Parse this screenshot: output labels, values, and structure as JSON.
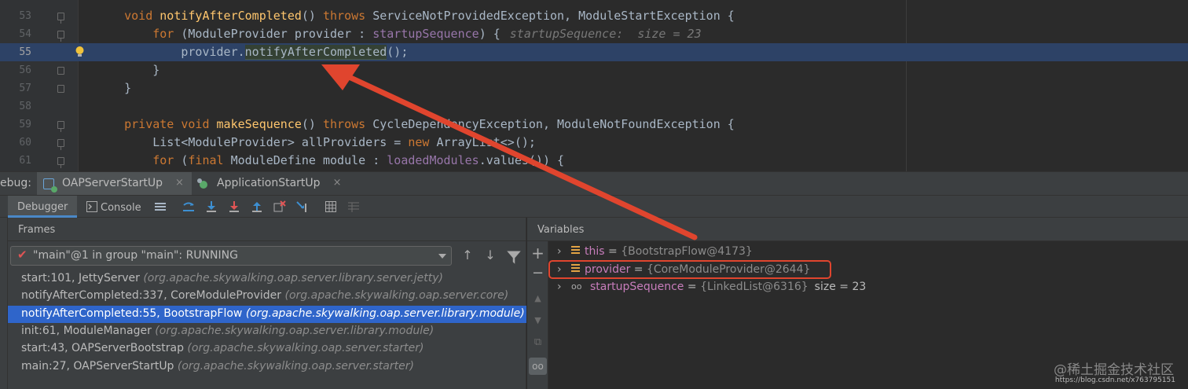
{
  "editor": {
    "lines": [
      {
        "num": "53",
        "parts": [
          [
            "    ",
            ""
          ],
          [
            "void ",
            "kw"
          ],
          [
            "notifyAfterCompleted",
            "fn"
          ],
          [
            "() ",
            ""
          ],
          [
            "throws ",
            "kw"
          ],
          [
            "ServiceNotProvidedException, ModuleStartException {",
            ""
          ]
        ]
      },
      {
        "num": "54",
        "parts": [
          [
            "        ",
            ""
          ],
          [
            "for ",
            "kw"
          ],
          [
            "(ModuleProvider provider : ",
            ""
          ],
          [
            "startupSequence",
            "fld"
          ],
          [
            ") {",
            ""
          ]
        ],
        "hint": "startupSequence:  size = 23"
      },
      {
        "num": "55",
        "parts": [
          [
            "            provider.",
            ""
          ],
          [
            "notifyAfterCompleted",
            "mcall"
          ],
          [
            "();",
            ""
          ]
        ]
      },
      {
        "num": "56",
        "parts": [
          [
            "        }",
            ""
          ]
        ]
      },
      {
        "num": "57",
        "parts": [
          [
            "    }",
            ""
          ]
        ]
      },
      {
        "num": "58",
        "parts": [
          [
            "",
            ""
          ]
        ]
      },
      {
        "num": "59",
        "parts": [
          [
            "    ",
            ""
          ],
          [
            "private void ",
            "kw"
          ],
          [
            "makeSequence",
            "fn"
          ],
          [
            "() ",
            ""
          ],
          [
            "throws ",
            "kw"
          ],
          [
            "CycleDependencyException, ModuleNotFoundException {",
            ""
          ]
        ]
      },
      {
        "num": "60",
        "parts": [
          [
            "        List<ModuleProvider> allProviders = ",
            ""
          ],
          [
            "new ",
            "kw"
          ],
          [
            "ArrayList<>();",
            ""
          ]
        ]
      },
      {
        "num": "61",
        "parts": [
          [
            "        ",
            ""
          ],
          [
            "for ",
            "kw"
          ],
          [
            "(",
            ""
          ],
          [
            "final ",
            "kw"
          ],
          [
            "ModuleDefine module : ",
            ""
          ],
          [
            "loadedModules",
            "fld"
          ],
          [
            ".values()) {",
            ""
          ]
        ]
      }
    ]
  },
  "debug": {
    "label": "ebug:",
    "tabs": [
      {
        "label": "OAPServerStartUp",
        "active": true
      },
      {
        "label": "ApplicationStartUp",
        "active": false
      }
    ],
    "close_glyph": "×"
  },
  "toolbar": {
    "debugger_label": "Debugger",
    "console_label": "Console"
  },
  "frames": {
    "header": "Frames",
    "thread": "\"main\"@1 in group \"main\": RUNNING",
    "rows": [
      {
        "method": "start:101, JettyServer",
        "pkg": "(org.apache.skywalking.oap.server.library.server.jetty)",
        "selected": false
      },
      {
        "method": "notifyAfterCompleted:337, CoreModuleProvider",
        "pkg": "(org.apache.skywalking.oap.server.core)",
        "selected": false
      },
      {
        "method": "notifyAfterCompleted:55, BootstrapFlow",
        "pkg": "(org.apache.skywalking.oap.server.library.module)",
        "selected": true
      },
      {
        "method": "init:61, ModuleManager",
        "pkg": "(org.apache.skywalking.oap.server.library.module)",
        "selected": false
      },
      {
        "method": "start:43, OAPServerBootstrap",
        "pkg": "(org.apache.skywalking.oap.server.starter)",
        "selected": false
      },
      {
        "method": "main:27, OAPServerStartUp",
        "pkg": "(org.apache.skywalking.oap.server.starter)",
        "selected": false
      }
    ]
  },
  "variables": {
    "header": "Variables",
    "rows": [
      {
        "name": "this",
        "eq": " = ",
        "value": "{BootstrapFlow@4173}",
        "extra": "",
        "icon": "field-icon"
      },
      {
        "name": "provider",
        "eq": " = ",
        "value": "{CoreModuleProvider@2644}",
        "extra": "",
        "icon": "field-icon"
      },
      {
        "name": "startupSequence",
        "eq": " = ",
        "value": "{LinkedList@6316}",
        "extra": "size = 23",
        "icon": "watch-glasses-icon"
      }
    ]
  },
  "watermark": {
    "text": "@稀土掘金技术社区",
    "url": "https://blog.csdn.net/x763795151"
  },
  "colors": {
    "annotation_red": "#e0452e",
    "selection_blue": "#2f65ca"
  }
}
